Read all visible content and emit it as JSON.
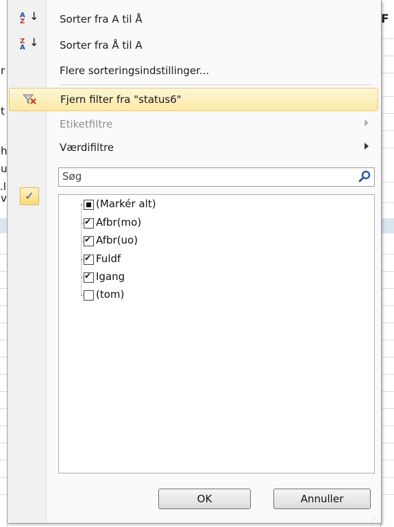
{
  "background": {
    "column_header": "F",
    "row_letters": [
      "r",
      "t",
      "h",
      "u",
      ".l",
      "v"
    ]
  },
  "menu": {
    "sort_asc": {
      "label": "Sorter fra A til Å",
      "icon": "sort-ascending-icon"
    },
    "sort_desc": {
      "label": "Sorter fra Å til A",
      "icon": "sort-descending-icon"
    },
    "more_sort": {
      "label": "Flere sorteringsindstillinger..."
    },
    "clear_filter": {
      "label": "Fjern filter fra \"status6\"",
      "icon": "clear-filter-icon"
    },
    "label_filters": {
      "label": "Etiketfiltre",
      "enabled": false
    },
    "value_filters": {
      "label": "Værdifiltre",
      "enabled": true
    },
    "search": {
      "placeholder": "Søg",
      "icon": "search-icon"
    },
    "tree_items": [
      {
        "label": "(Markér alt)",
        "state": "partial"
      },
      {
        "label": "Afbr(mo)",
        "state": "checked"
      },
      {
        "label": "Afbr(uo)",
        "state": "checked"
      },
      {
        "label": "Fuldf",
        "state": "checked"
      },
      {
        "label": "Igang",
        "state": "checked"
      },
      {
        "label": "(tom)",
        "state": "unchecked"
      }
    ],
    "ok_label": "OK",
    "cancel_label": "Annuller"
  },
  "colors": {
    "highlight": "#fbe9a6",
    "accent_blue": "#1f4fa8",
    "accent_red": "#c0392b"
  }
}
